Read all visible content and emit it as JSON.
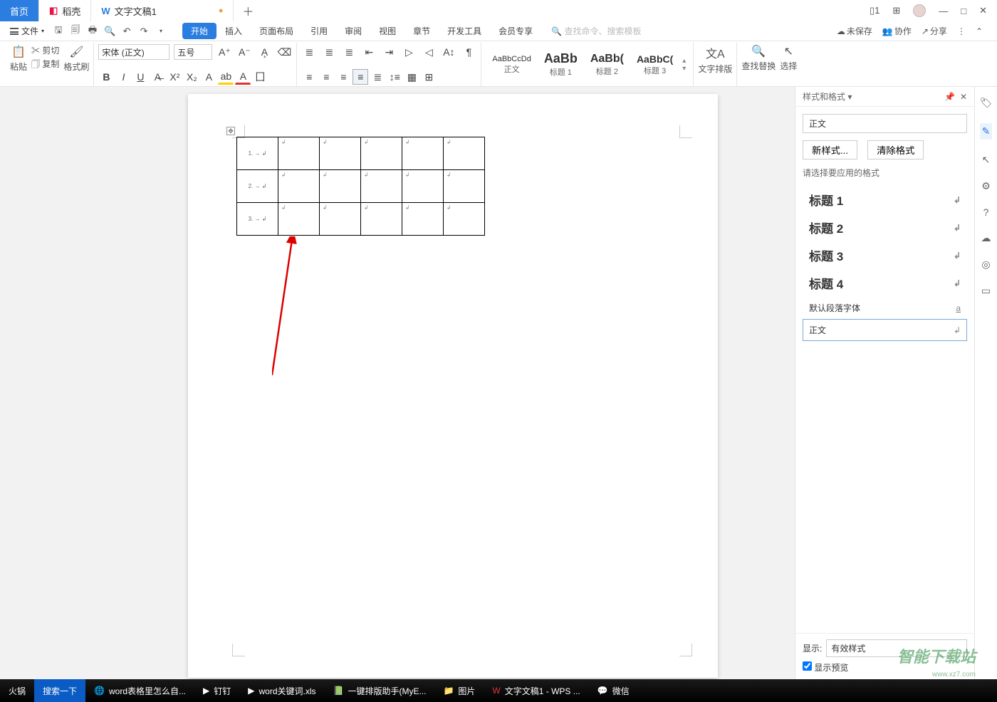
{
  "titlebar": {
    "tab_home": "首页",
    "tab_doke": "稻壳",
    "tab_doc": "文字文稿1",
    "win_box": "1"
  },
  "menubar": {
    "file": "文件",
    "tabs": [
      "开始",
      "插入",
      "页面布局",
      "引用",
      "审阅",
      "视图",
      "章节",
      "开发工具",
      "会员专享"
    ],
    "search_ph": "查找命令、搜索模板",
    "unsaved": "未保存",
    "collab": "协作",
    "share": "分享"
  },
  "ribbon": {
    "paste": "粘贴",
    "cut": "剪切",
    "copy": "复制",
    "formatbrush": "格式刷",
    "font_name": "宋体 (正文)",
    "font_size": "五号",
    "styles": [
      {
        "prev": "AaBbCcDd",
        "label": "正文"
      },
      {
        "prev": "AaBb",
        "label": "标题 1"
      },
      {
        "prev": "AaBb(",
        "label": "标题 2"
      },
      {
        "prev": "AaBbC(",
        "label": "标题 3"
      }
    ],
    "layout_btn": "文字排版",
    "find_btn": "查找替换",
    "select_btn": "选择"
  },
  "doc": {
    "rows": [
      "1. → ↲",
      "2. → ↲",
      "3. → ↲"
    ]
  },
  "panel": {
    "title": "样式和格式",
    "current": "正文",
    "new_style": "新样式...",
    "clear": "清除格式",
    "hint": "请选择要应用的格式",
    "items": [
      "标题 1",
      "标题 2",
      "标题 3",
      "标题 4"
    ],
    "default_para": "默认段落字体",
    "body": "正文",
    "show_label": "显示:",
    "show_value": "有效样式",
    "preview": "显示预览"
  },
  "taskbar": {
    "hotpot": "火锅",
    "search": "搜索一下",
    "items": [
      "word表格里怎么自...",
      "钉钉",
      "word关键词.xls",
      "一键排版助手(MyE...",
      "图片",
      "文字文稿1 - WPS ...",
      "微信"
    ]
  },
  "watermark": {
    "m": "智能下载站",
    "u": "www.xz7.com"
  }
}
